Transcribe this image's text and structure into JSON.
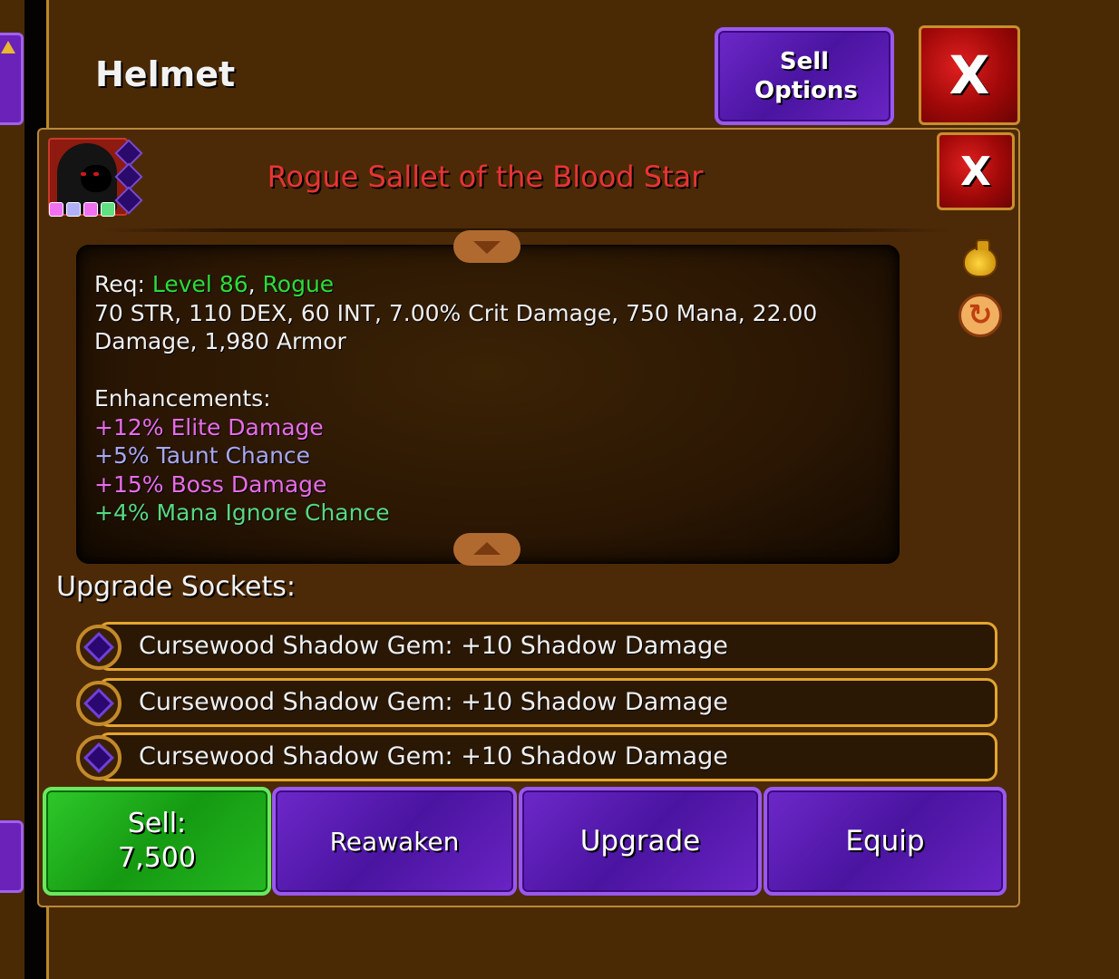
{
  "header": {
    "title": "Helmet",
    "sell_options_label": "Sell Options",
    "close_label": "X"
  },
  "item": {
    "name": "Rogue Sallet of the Blood Star",
    "close_label": "X",
    "enhancement_dot_colors": [
      "#f070f0",
      "#b0b0f8",
      "#f070f0",
      "#60e080"
    ],
    "requirements": {
      "prefix": "Req: ",
      "level": "Level 86",
      "separator": ", ",
      "class": "Rogue"
    },
    "stats_line1": "70 STR, 110 DEX, 60 INT, 7.00% Crit Damage, 750 Mana, 22.00",
    "stats_line2": "Damage, 1,980 Armor",
    "enhancements_label": "Enhancements:",
    "enhancements": [
      {
        "text": "+12% Elite Damage",
        "color": "#e86ce8"
      },
      {
        "text": "+5% Taunt Chance",
        "color": "#a8a8f0"
      },
      {
        "text": "+15% Boss Damage",
        "color": "#e86ce8"
      },
      {
        "text": "+4% Mana Ignore Chance",
        "color": "#58d880"
      }
    ],
    "side_icons": [
      "gold-bag-icon",
      "swap-icon"
    ]
  },
  "upgrade_sockets": {
    "label": "Upgrade Sockets:",
    "sockets": [
      {
        "text": "Cursewood Shadow Gem: +10 Shadow Damage"
      },
      {
        "text": "Cursewood Shadow Gem: +10 Shadow Damage"
      },
      {
        "text": "Cursewood Shadow Gem: +10 Shadow Damage"
      }
    ]
  },
  "actions": {
    "sell_label": "Sell:",
    "sell_price": "7,500",
    "reawaken_label": "Reawaken",
    "upgrade_label": "Upgrade",
    "equip_label": "Equip"
  },
  "colors": {
    "item_name": "#e83434",
    "requirement_highlight": "#2ddc3a",
    "purple_button": "#5a1cb0",
    "green_button": "#1aa818",
    "socket_border": "#e3a52e"
  }
}
